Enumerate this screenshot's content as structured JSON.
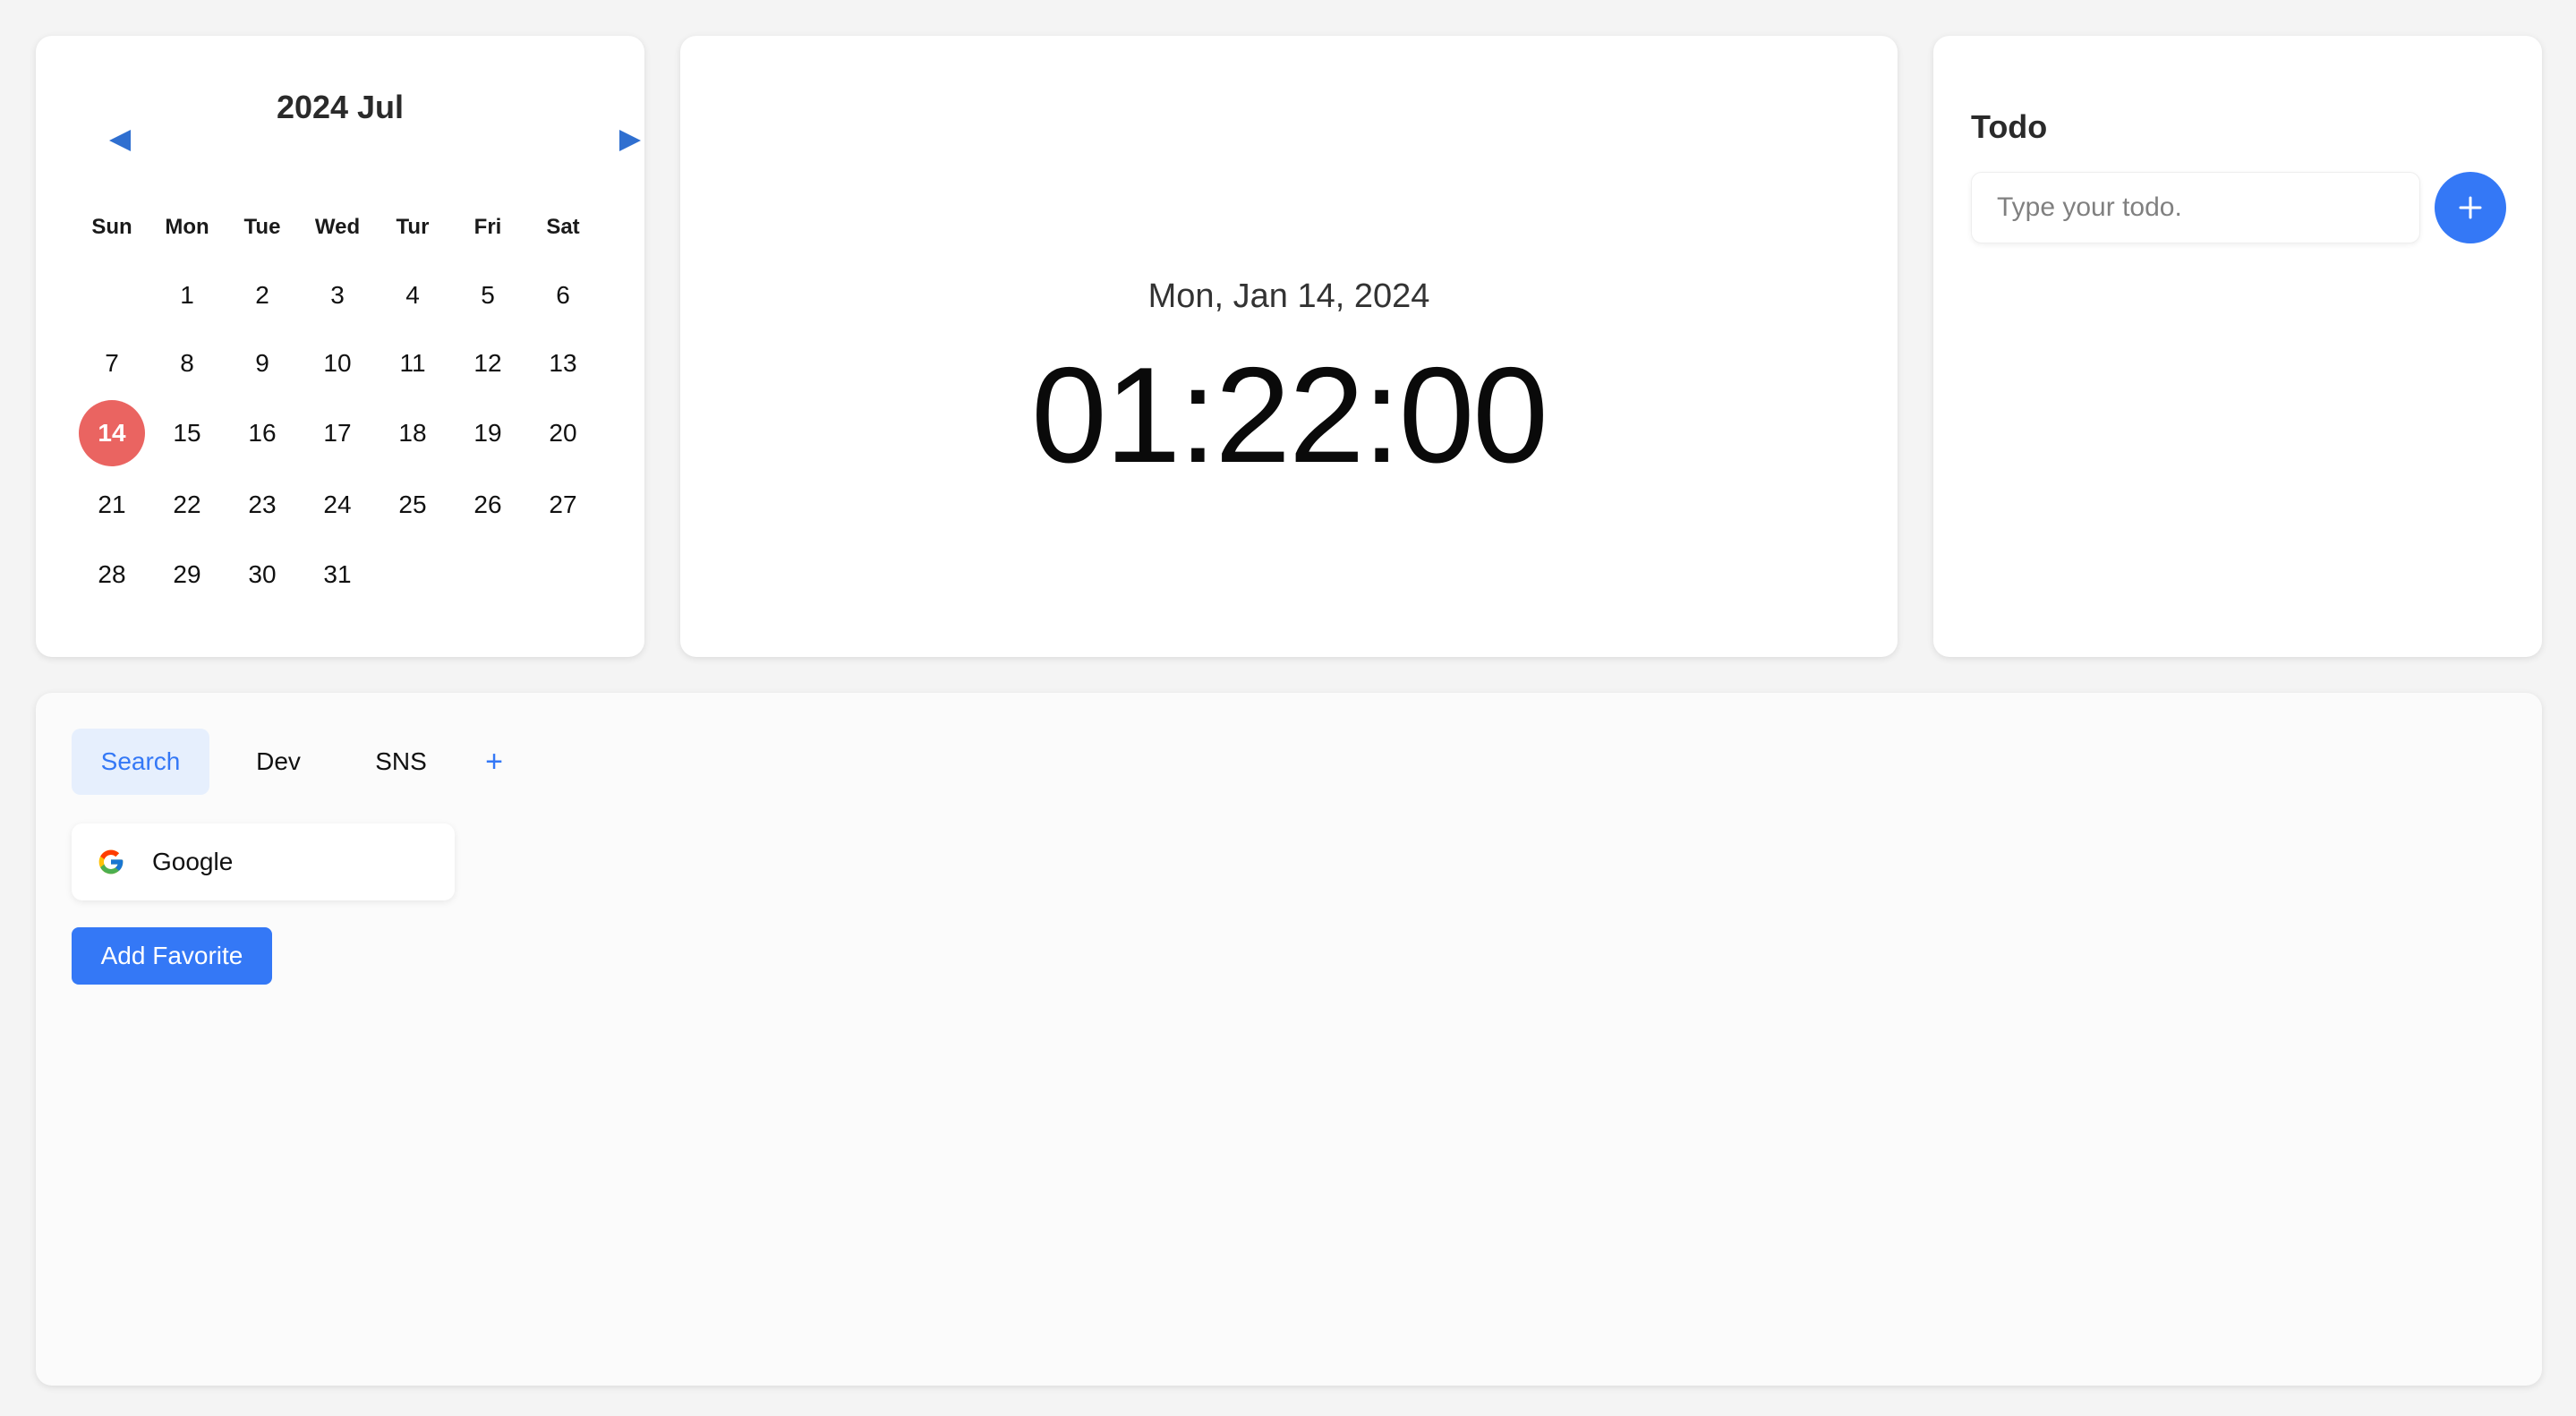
{
  "calendar": {
    "title": "2024 Jul",
    "prev_icon": "triangle-left-icon",
    "next_icon": "triangle-right-icon",
    "weekdays": [
      "Sun",
      "Mon",
      "Tue",
      "Wed",
      "Tur",
      "Fri",
      "Sat"
    ],
    "weeks": [
      [
        "",
        "1",
        "2",
        "3",
        "4",
        "5",
        "6"
      ],
      [
        "7",
        "8",
        "9",
        "10",
        "11",
        "12",
        "13"
      ],
      [
        "14",
        "15",
        "16",
        "17",
        "18",
        "19",
        "20"
      ],
      [
        "21",
        "22",
        "23",
        "24",
        "25",
        "26",
        "27"
      ],
      [
        "28",
        "29",
        "30",
        "31",
        "",
        "",
        ""
      ]
    ],
    "selected_day": "14",
    "selected_color": "#ea6461",
    "accent_color": "#2f6fd0"
  },
  "clock": {
    "date": "Mon, Jan 14, 2024",
    "time": "01:22:00"
  },
  "todo": {
    "title": "Todo",
    "input_placeholder": "Type your todo.",
    "input_value": "",
    "add_icon": "plus-icon",
    "accent_color": "#3478f6"
  },
  "favorites": {
    "tabs": [
      {
        "label": "Search",
        "active": true
      },
      {
        "label": "Dev",
        "active": false
      },
      {
        "label": "SNS",
        "active": false
      }
    ],
    "add_tab_label": "+",
    "items": [
      {
        "label": "Google",
        "icon": "google-icon"
      }
    ],
    "add_button_label": "Add Favorite",
    "accent_color": "#3478f6"
  }
}
